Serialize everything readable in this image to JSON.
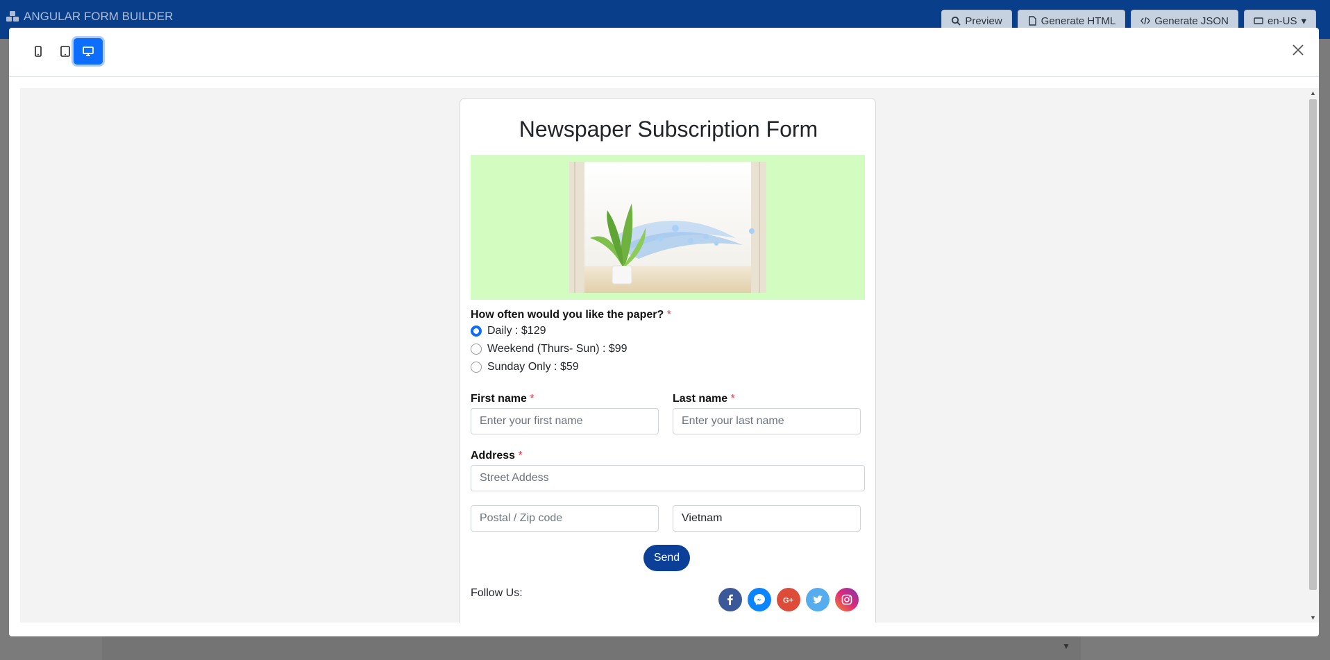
{
  "app": {
    "brand": "ANGULAR FORM BUILDER",
    "actions": [
      "Preview",
      "Generate HTML",
      "Generate JSON",
      "en-US"
    ]
  },
  "modal": {
    "device_icons": [
      "mobile-icon",
      "tablet-icon",
      "desktop-icon"
    ],
    "active_device": "desktop"
  },
  "form": {
    "title": "Newspaper Subscription Form",
    "question": "How often would you like the paper?",
    "required_mark": "*",
    "options": [
      "Daily : $129",
      "Weekend (Thurs- Sun) : $99",
      "Sunday Only : $59"
    ],
    "selected_option": "Daily : $129",
    "first_name": {
      "label": "First name",
      "placeholder": "Enter your first name"
    },
    "last_name": {
      "label": "Last name",
      "placeholder": "Enter your last name"
    },
    "address": {
      "label": "Address",
      "placeholder": "Street Addess"
    },
    "postal": {
      "placeholder": "Postal / Zip code"
    },
    "country": {
      "value": "Vietnam"
    },
    "send_label": "Send",
    "follow_label": "Follow Us:",
    "socials": [
      "facebook-icon",
      "messenger-icon",
      "google-plus-icon",
      "twitter-icon",
      "instagram-icon"
    ]
  },
  "colors": {
    "accent": "#0d6efd",
    "header": "#083e8a",
    "hero_bg": "#d3fdc0",
    "send_bg": "#0b3f98",
    "required": "#dc3545"
  }
}
